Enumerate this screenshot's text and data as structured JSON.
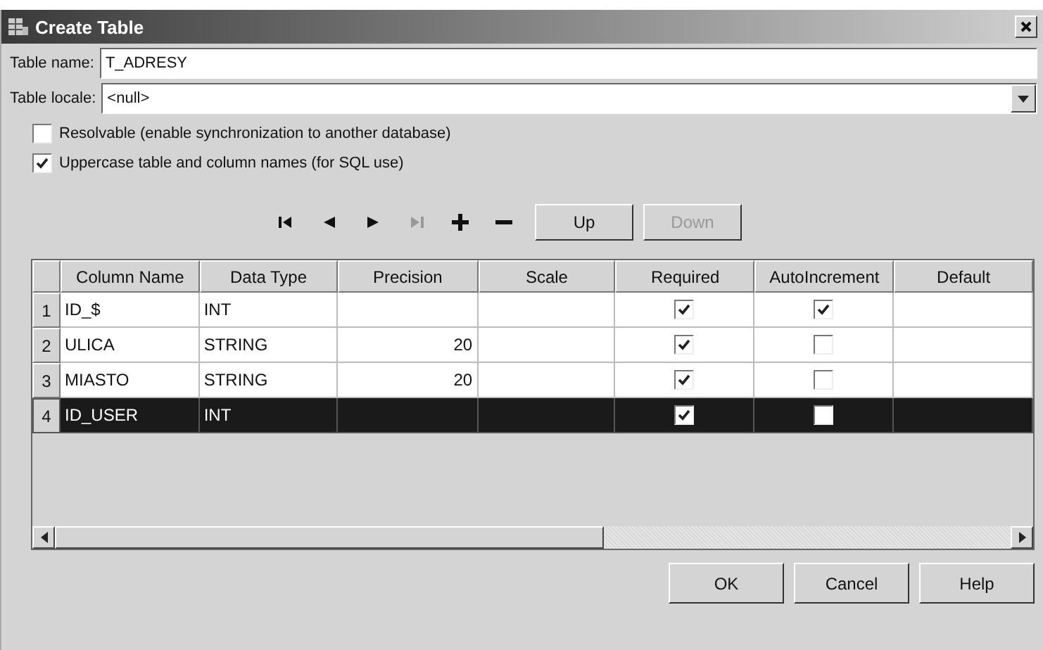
{
  "window": {
    "title": "Create Table"
  },
  "fields": [
    {
      "label": "Table name:",
      "value": "T_ADRESY",
      "kind": "text"
    },
    {
      "label": "Table locale:",
      "value": "<null>",
      "kind": "dropdown"
    }
  ],
  "options": [
    {
      "label": "Resolvable (enable synchronization to another database)",
      "checked": false
    },
    {
      "label": "Uppercase table and column names (for SQL use)",
      "checked": true
    }
  ],
  "toolbar": {
    "nav": [
      {
        "kind": "first",
        "disabled": false
      },
      {
        "kind": "prev",
        "disabled": false
      },
      {
        "kind": "next",
        "disabled": false
      },
      {
        "kind": "last",
        "disabled": true
      },
      {
        "kind": "add",
        "disabled": false
      },
      {
        "kind": "remove",
        "disabled": false
      }
    ],
    "buttons": [
      {
        "label": "Up",
        "disabled": false
      },
      {
        "label": "Down",
        "disabled": true
      }
    ]
  },
  "table": {
    "columns": [
      "Column Name",
      "Data Type",
      "Precision",
      "Scale",
      "Required",
      "AutoIncrement",
      "Default"
    ],
    "rows": [
      {
        "number": "1",
        "name": "ID_$",
        "type": "INT",
        "precision": "",
        "required": true,
        "autoincrement": true,
        "selected": false
      },
      {
        "number": "2",
        "name": "ULICA",
        "type": "STRING",
        "precision": "20",
        "required": true,
        "autoincrement": false,
        "selected": false
      },
      {
        "number": "3",
        "name": "MIASTO",
        "type": "STRING",
        "precision": "20",
        "required": true,
        "autoincrement": false,
        "selected": false
      },
      {
        "number": "4",
        "name": "ID_USER",
        "type": "INT",
        "precision": "",
        "required": true,
        "autoincrement": false,
        "selected": true
      }
    ]
  },
  "buttons": [
    "OK",
    "Cancel",
    "Help"
  ]
}
